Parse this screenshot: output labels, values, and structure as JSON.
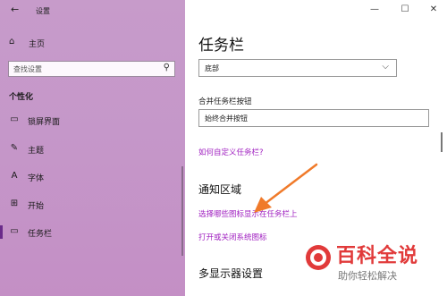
{
  "window": {
    "back_icon": "←",
    "title": "设置",
    "minimize_icon": "—",
    "maximize_icon": "☐",
    "close_icon": "✕"
  },
  "sidebar": {
    "home": {
      "icon": "⌂",
      "label": "主页"
    },
    "search_placeholder": "查找设置",
    "search_icon": "⚲",
    "section_title": "个性化",
    "items": [
      {
        "icon": "▭",
        "label": "锁屏界面"
      },
      {
        "icon": "✎",
        "label": "主题"
      },
      {
        "icon": "A",
        "label": "字体"
      },
      {
        "icon": "⊞",
        "label": "开始"
      },
      {
        "icon": "▭",
        "label": "任务栏"
      }
    ]
  },
  "main": {
    "title": "任务栏",
    "position_value": "底部",
    "combine_label": "合并任务栏按钮",
    "combine_value": "始终合并按钮",
    "customize_link": "如何自定义任务栏?",
    "notify_title": "通知区域",
    "notify_link1": "选择哪些图标显示在任务栏上",
    "notify_link2": "打开或关闭系统图标",
    "multi_title": "多显示器设置"
  },
  "watermark": {
    "title": "百科全说",
    "subtitle": "助你轻松解决",
    "title_color": "#e13a3a"
  },
  "colors": {
    "sidebar_bg": "#c597c9",
    "link": "#a020c0",
    "active_bar": "#6a2b8a",
    "arrow": "#f07a2a"
  }
}
